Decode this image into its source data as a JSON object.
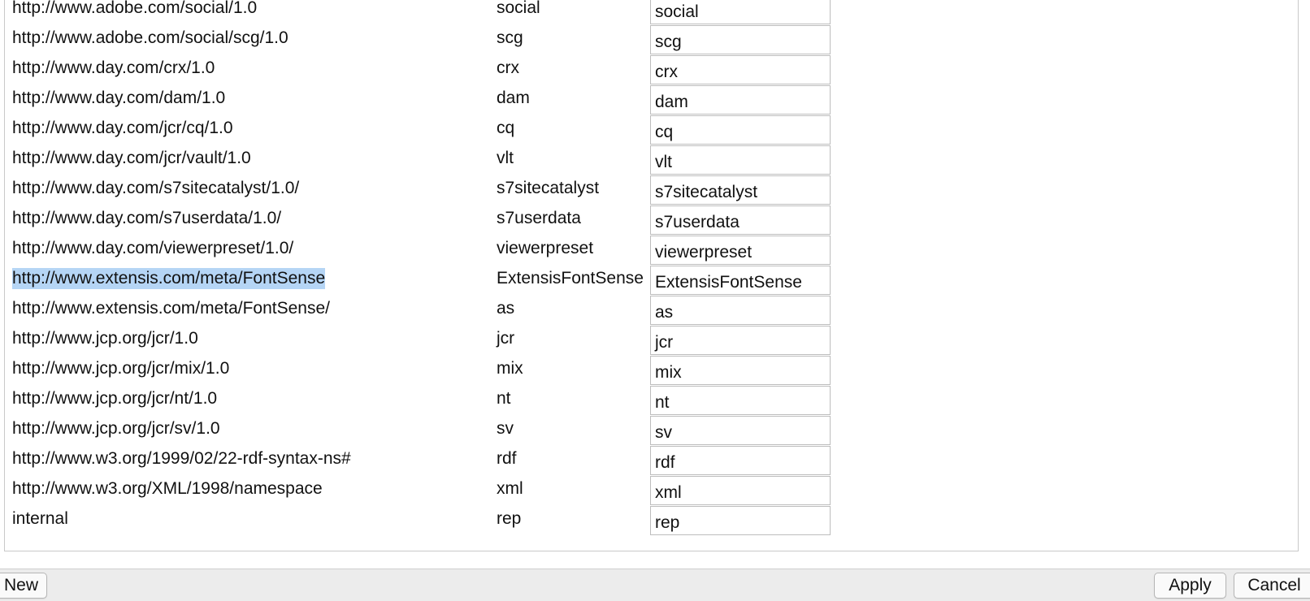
{
  "namespaces": [
    {
      "uri": "http://www.adobe.com/social/1.0",
      "prefix": "social",
      "value": "social",
      "selected": false
    },
    {
      "uri": "http://www.adobe.com/social/scg/1.0",
      "prefix": "scg",
      "value": "scg",
      "selected": false
    },
    {
      "uri": "http://www.day.com/crx/1.0",
      "prefix": "crx",
      "value": "crx",
      "selected": false
    },
    {
      "uri": "http://www.day.com/dam/1.0",
      "prefix": "dam",
      "value": "dam",
      "selected": false
    },
    {
      "uri": "http://www.day.com/jcr/cq/1.0",
      "prefix": "cq",
      "value": "cq",
      "selected": false
    },
    {
      "uri": "http://www.day.com/jcr/vault/1.0",
      "prefix": "vlt",
      "value": "vlt",
      "selected": false
    },
    {
      "uri": "http://www.day.com/s7sitecatalyst/1.0/",
      "prefix": "s7sitecatalyst",
      "value": "s7sitecatalyst",
      "selected": false
    },
    {
      "uri": "http://www.day.com/s7userdata/1.0/",
      "prefix": "s7userdata",
      "value": "s7userdata",
      "selected": false
    },
    {
      "uri": "http://www.day.com/viewerpreset/1.0/",
      "prefix": "viewerpreset",
      "value": "viewerpreset",
      "selected": false
    },
    {
      "uri": "http://www.extensis.com/meta/FontSense",
      "prefix": "ExtensisFontSense",
      "value": "ExtensisFontSense",
      "selected": true
    },
    {
      "uri": "http://www.extensis.com/meta/FontSense/",
      "prefix": "as",
      "value": "as",
      "selected": false
    },
    {
      "uri": "http://www.jcp.org/jcr/1.0",
      "prefix": "jcr",
      "value": "jcr",
      "selected": false
    },
    {
      "uri": "http://www.jcp.org/jcr/mix/1.0",
      "prefix": "mix",
      "value": "mix",
      "selected": false
    },
    {
      "uri": "http://www.jcp.org/jcr/nt/1.0",
      "prefix": "nt",
      "value": "nt",
      "selected": false
    },
    {
      "uri": "http://www.jcp.org/jcr/sv/1.0",
      "prefix": "sv",
      "value": "sv",
      "selected": false
    },
    {
      "uri": "http://www.w3.org/1999/02/22-rdf-syntax-ns#",
      "prefix": "rdf",
      "value": "rdf",
      "selected": false
    },
    {
      "uri": "http://www.w3.org/XML/1998/namespace",
      "prefix": "xml",
      "value": "xml",
      "selected": false
    },
    {
      "uri": "internal",
      "prefix": "rep",
      "value": "rep",
      "selected": false
    }
  ],
  "footer": {
    "new_label": "New",
    "apply_label": "Apply",
    "cancel_label": "Cancel"
  },
  "colors": {
    "selection": "#b5d5f5",
    "footer_bg": "#ececec"
  }
}
